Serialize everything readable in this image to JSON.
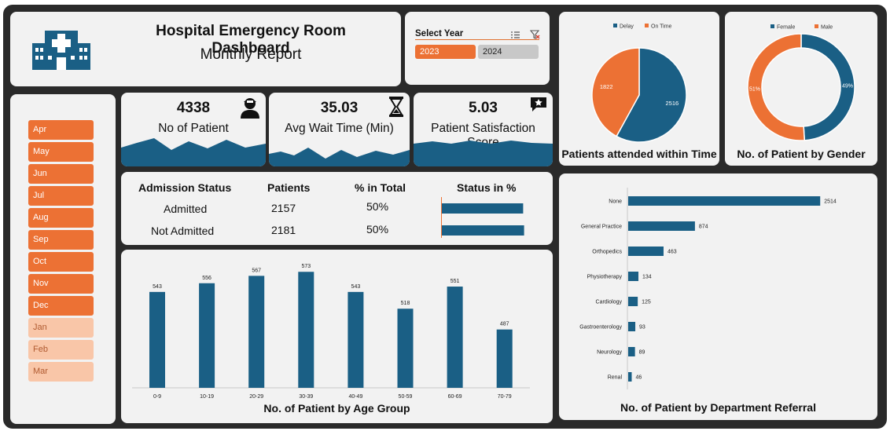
{
  "header": {
    "title": "Hospital Emergency Room Dashboard",
    "subtitle": "Monthly Report",
    "icon": "hospital-icon"
  },
  "year_slicer": {
    "title": "Select Year",
    "years": [
      {
        "label": "2023",
        "selected": true
      },
      {
        "label": "2024",
        "selected": false
      }
    ],
    "colors": {
      "selected": "#ec7134",
      "unselected": "#c8c8c8"
    }
  },
  "month_slicer": {
    "months": [
      {
        "label": "Apr",
        "selected": true
      },
      {
        "label": "May",
        "selected": true
      },
      {
        "label": "Jun",
        "selected": true
      },
      {
        "label": "Jul",
        "selected": true
      },
      {
        "label": "Aug",
        "selected": true
      },
      {
        "label": "Sep",
        "selected": true
      },
      {
        "label": "Oct",
        "selected": true
      },
      {
        "label": "Nov",
        "selected": true
      },
      {
        "label": "Dec",
        "selected": true
      },
      {
        "label": "Jan",
        "selected": false
      },
      {
        "label": "Feb",
        "selected": false
      },
      {
        "label": "Mar",
        "selected": false
      }
    ]
  },
  "kpis": {
    "patients": {
      "value": "4338",
      "label": "No of Patient",
      "icon": "patient-icon"
    },
    "wait": {
      "value": "35.03",
      "label": "Avg Wait Time (Min)",
      "icon": "hourglass-icon"
    },
    "satisfaction": {
      "value": "5.03",
      "label": "Patient Satisfaction Score",
      "icon": "star-review-icon"
    }
  },
  "admission": {
    "headers": [
      "Admission Status",
      "Patients",
      "% in Total",
      "Status in %"
    ],
    "rows": [
      {
        "status": "Admitted",
        "patients": "2157",
        "pct": "50%",
        "fraction": 0.497
      },
      {
        "status": "Not Admitted",
        "patients": "2181",
        "pct": "50%",
        "fraction": 0.503
      }
    ]
  },
  "colors": {
    "blue": "#1a5f85",
    "orange": "#ec7134",
    "panel": "#f2f2f2",
    "frame": "#2a2a2a"
  },
  "chart_data": [
    {
      "type": "pie",
      "title": "Patients attended within Time",
      "legend": "top",
      "categories": [
        "Delay",
        "On Time"
      ],
      "values": [
        2516,
        1822
      ],
      "colors": [
        "#1a5f85",
        "#ec7134"
      ]
    },
    {
      "type": "pie",
      "title": "No. of Patient by Gender",
      "legend": "top",
      "donut": true,
      "categories": [
        "Female",
        "Male"
      ],
      "values": [
        49,
        51
      ],
      "labels": [
        "49%",
        "51%"
      ],
      "colors": [
        "#1a5f85",
        "#ec7134"
      ]
    },
    {
      "type": "bar",
      "title": "No. of Patient by Age Group",
      "categories": [
        "0-9",
        "10-19",
        "20-29",
        "30-39",
        "40-49",
        "50-59",
        "60-69",
        "70-79"
      ],
      "values": [
        543,
        556,
        567,
        573,
        543,
        518,
        551,
        487
      ],
      "ylim": [
        400,
        585
      ],
      "grid": false
    },
    {
      "type": "bar",
      "orientation": "horizontal",
      "title": "No. of Patient by Department Referral",
      "categories": [
        "None",
        "General Practice",
        "Orthopedics",
        "Physiotherapy",
        "Cardiology",
        "Gastroenterology",
        "Neurology",
        "Renal"
      ],
      "values": [
        2514,
        874,
        463,
        134,
        125,
        93,
        89,
        46
      ],
      "xlim": [
        0,
        2800
      ],
      "grid": false
    }
  ]
}
